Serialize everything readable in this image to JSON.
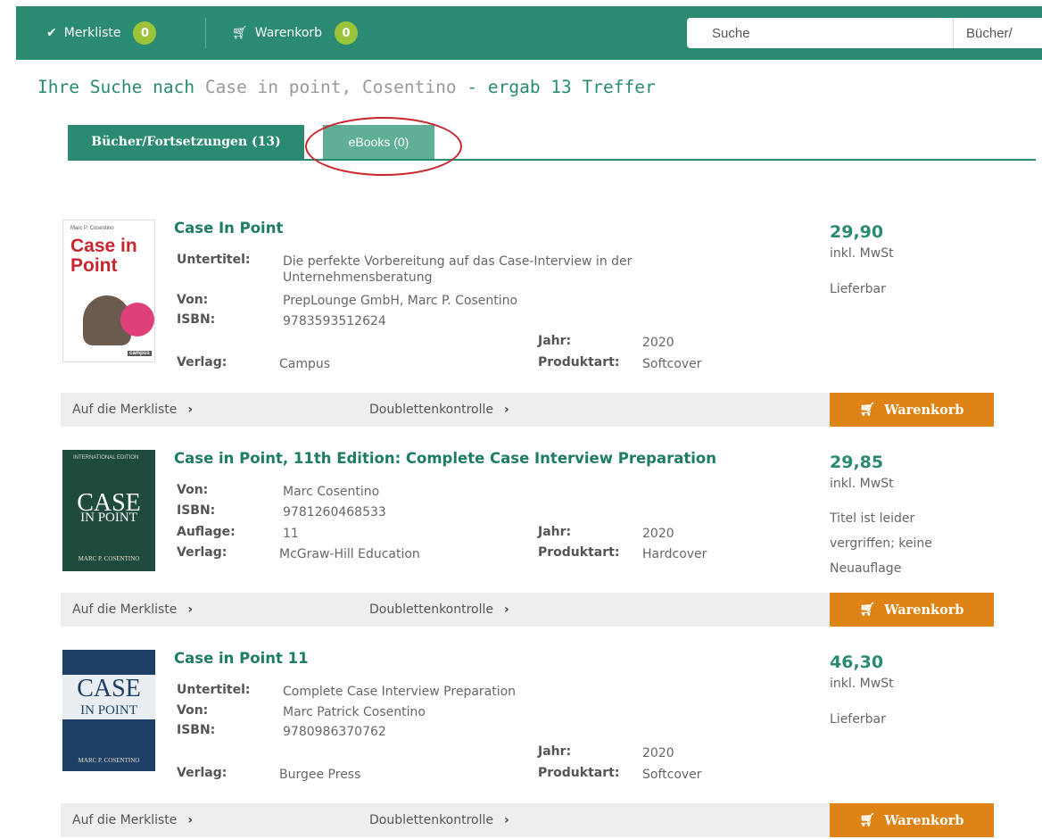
{
  "topbar": {
    "merkliste_label": "Merkliste",
    "merkliste_count": "0",
    "warenkorb_label": "Warenkorb",
    "warenkorb_count": "0",
    "search_placeholder": "Suche",
    "search_scope": "Bücher/"
  },
  "heading": {
    "prefix": "Ihre Suche nach",
    "query": "Case in point, Cosentino",
    "suffix": "- ergab 13 Treffer"
  },
  "tabs": [
    {
      "label": "Bücher/Fortsetzungen (13)",
      "active": true
    },
    {
      "label": "eBooks (0)",
      "active": false
    }
  ],
  "labels": {
    "untertitel": "Untertitel:",
    "von": "Von:",
    "isbn": "ISBN:",
    "auflage": "Auflage:",
    "verlag": "Verlag:",
    "jahr": "Jahr:",
    "produktart": "Produktart:",
    "price_note": "inkl. MwSt",
    "merkliste_link": "Auf die Merkliste",
    "doubletten_link": "Doublettenkontrolle",
    "cart_button": "Warenkorb"
  },
  "results": [
    {
      "title": "Case In Point",
      "untertitel": "Die perfekte Vorbereitung auf das Case-Interview in der Unternehmensberatung",
      "von": "PrepLounge GmbH, Marc P. Cosentino",
      "isbn": "9783593512624",
      "verlag": "Campus",
      "jahr": "2020",
      "produktart": "Softcover",
      "price": "29,90",
      "availability": "Lieferbar",
      "cover_text": [
        "Marc P. Cosentino",
        "Case in",
        "Point",
        "campus"
      ]
    },
    {
      "title": "Case in Point, 11th Edition: Complete Case Interview Preparation",
      "von": "Marc Cosentino",
      "isbn": "9781260468533",
      "auflage": "11",
      "verlag": "McGraw-Hill Education",
      "jahr": "2020",
      "produktart": "Hardcover",
      "price": "29,85",
      "availability": "Titel ist leider vergriffen; keine Neuauflage",
      "cover_text": [
        "INTERNATIONAL EDITION",
        "CASE",
        "IN POINT",
        "MARC P. COSENTINO"
      ]
    },
    {
      "title": "Case in Point 11",
      "untertitel": "Complete Case Interview Preparation",
      "von": "Marc Patrick Cosentino",
      "isbn": "9780986370762",
      "verlag": "Burgee Press",
      "jahr": "2020",
      "produktart": "Softcover",
      "price": "46,30",
      "availability": "Lieferbar",
      "cover_text": [
        "CASE",
        "IN POINT",
        "MARC P. COSENTINO"
      ]
    }
  ],
  "colors": {
    "brand": "#2a8a72",
    "badge": "#9bc43a",
    "cart_button": "#de8416",
    "annotation": "#c8252d"
  }
}
